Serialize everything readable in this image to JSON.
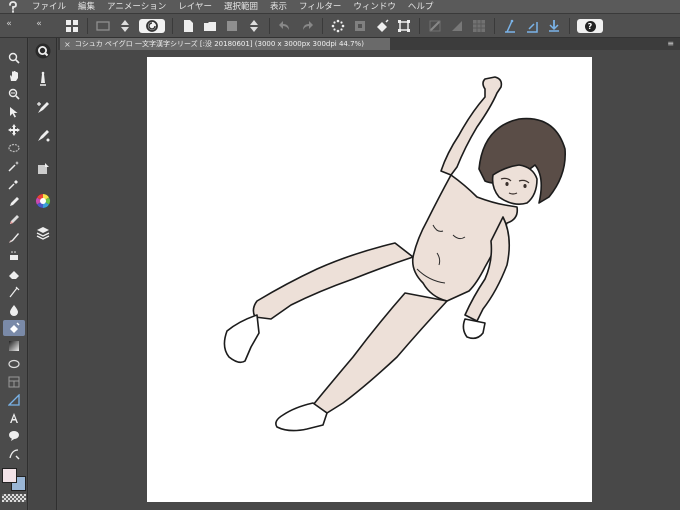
{
  "menu": {
    "logo": "̽",
    "items": [
      "ファイル",
      "編集",
      "アニメーション",
      "レイヤー",
      "選択範囲",
      "表示",
      "フィルター",
      "ウィンドウ",
      "ヘルプ"
    ]
  },
  "command_bar": {
    "collapse_left": "«",
    "collapse_right": "«",
    "help_label": "?"
  },
  "document_tab": {
    "close": "×",
    "title": "コシュカ ペイグロ 一文字漢字シリーズ [:没 20180601] (3000 x 3000px 300dpi 44.7%)",
    "menu": "≡"
  },
  "colors": {
    "main_color": "#f2e3e8",
    "sub_color": "#9ab6d6",
    "skin": "#ede0d8",
    "hair": "#5a4d47"
  }
}
